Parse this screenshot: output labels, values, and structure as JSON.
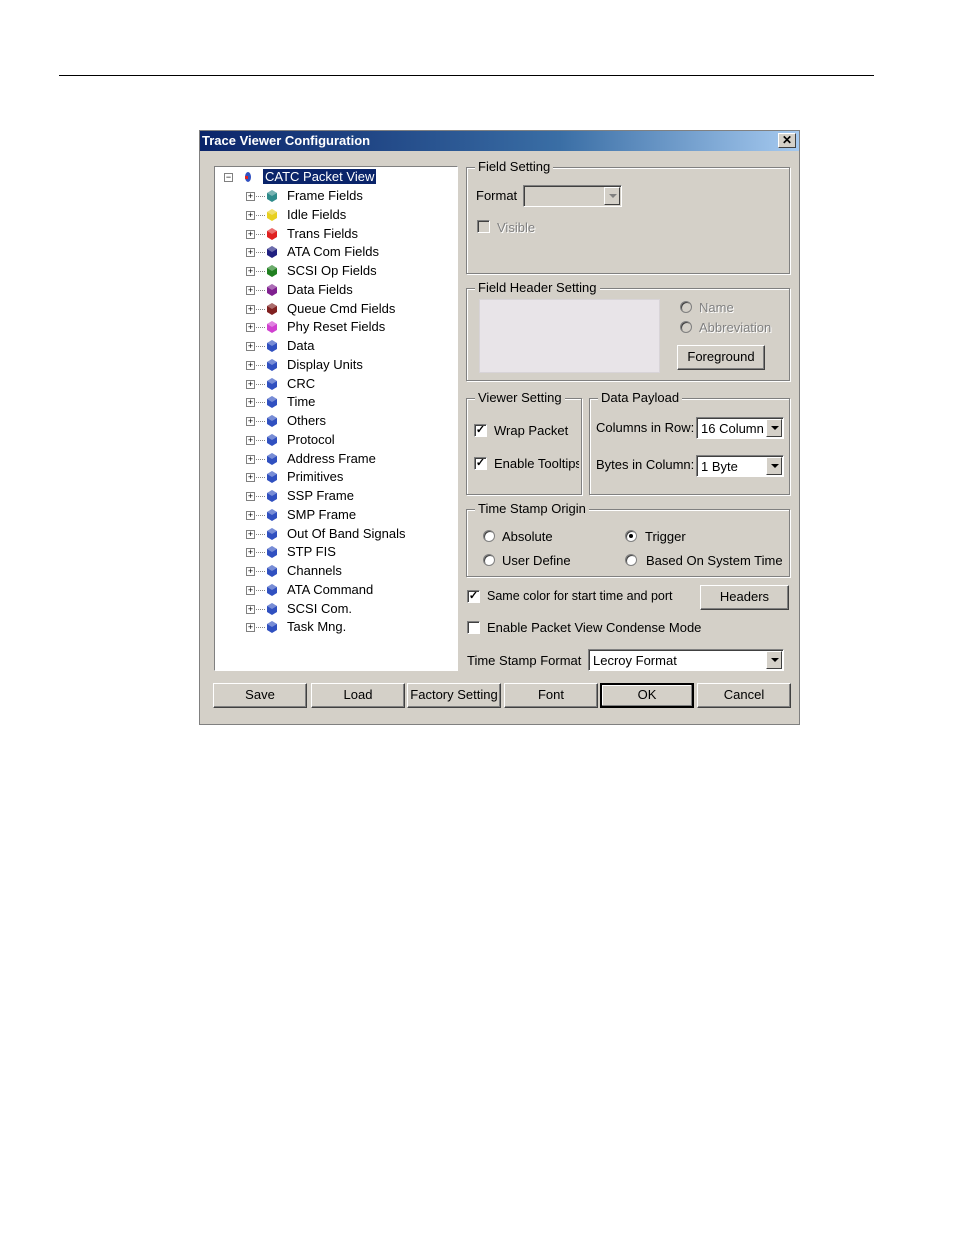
{
  "dialog": {
    "title": "Trace Viewer Configuration",
    "close_glyph": "✕"
  },
  "tree": {
    "root": {
      "label": "CATC Packet View",
      "expander": "−"
    },
    "items": [
      {
        "label": "Frame Fields",
        "color": "#2e8b8b"
      },
      {
        "label": "Idle Fields",
        "color": "#e8d020"
      },
      {
        "label": "Trans Fields",
        "color": "#e02020"
      },
      {
        "label": "ATA Com Fields",
        "color": "#202080"
      },
      {
        "label": "SCSI Op Fields",
        "color": "#208020"
      },
      {
        "label": "Data Fields",
        "color": "#802090"
      },
      {
        "label": "Queue Cmd Fields",
        "color": "#802020"
      },
      {
        "label": "Phy Reset Fields",
        "color": "#d040d0"
      },
      {
        "label": "Data",
        "color": "#3050c0"
      },
      {
        "label": "Display Units",
        "color": "#3050c0"
      },
      {
        "label": "CRC",
        "color": "#3050c0"
      },
      {
        "label": "Time",
        "color": "#3050c0"
      },
      {
        "label": "Others",
        "color": "#3050c0"
      },
      {
        "label": "Protocol",
        "color": "#3050c0"
      },
      {
        "label": "Address Frame",
        "color": "#3050c0"
      },
      {
        "label": "Primitives",
        "color": "#3050c0"
      },
      {
        "label": "SSP Frame",
        "color": "#3050c0"
      },
      {
        "label": "SMP Frame",
        "color": "#3050c0"
      },
      {
        "label": "Out Of Band Signals",
        "color": "#3050c0"
      },
      {
        "label": "STP FIS",
        "color": "#3050c0"
      },
      {
        "label": "Channels",
        "color": "#3050c0"
      },
      {
        "label": "ATA Command",
        "color": "#3050c0"
      },
      {
        "label": "SCSI Com.",
        "color": "#3050c0"
      },
      {
        "label": "Task Mng.",
        "color": "#3050c0"
      }
    ],
    "expander": "+"
  },
  "field_setting": {
    "legend": "Field Setting",
    "format_label": "Format",
    "format_value": "",
    "visible_label": "Visible"
  },
  "field_header_setting": {
    "legend": "Field Header Setting",
    "name_label": "Name",
    "abbreviation_label": "Abbreviation",
    "foreground_label": "Foreground"
  },
  "viewer_setting": {
    "legend": "Viewer Setting",
    "wrap_packet_label": "Wrap Packet",
    "enable_tooltips_label": "Enable Tooltips",
    "check_glyph": "✓"
  },
  "data_payload": {
    "legend": "Data Payload",
    "columns_label": "Columns in Row:",
    "columns_value": "16  Column",
    "bytes_label": "Bytes in Column:",
    "bytes_value": "1  Byte"
  },
  "time_stamp_origin": {
    "legend": "Time Stamp Origin",
    "absolute_label": "Absolute",
    "trigger_label": "Trigger",
    "user_define_label": "User Define",
    "system_time_label": "Based On System Time"
  },
  "options": {
    "same_color_label": "Same color for start time and port",
    "condense_label": "Enable Packet View Condense Mode",
    "headers_label": "Headers",
    "ts_format_label": "Time Stamp Format",
    "ts_format_value": "Lecroy Format"
  },
  "buttons": {
    "save": "Save",
    "load": "Load",
    "factory": "Factory Setting",
    "font": "Font",
    "ok": "OK",
    "cancel": "Cancel"
  }
}
